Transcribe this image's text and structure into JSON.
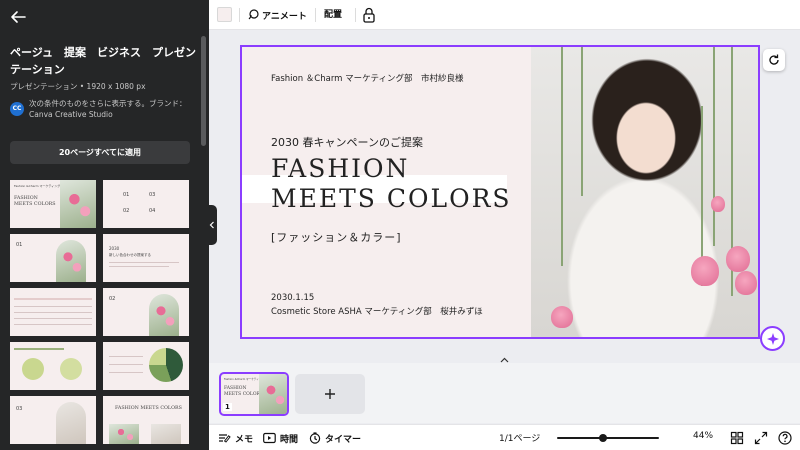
{
  "left_panel": {
    "title": "ページュ　提案　ビジネス　プレゼンテーション",
    "subtitle": "プレゼンテーション • 1920 x 1080 px",
    "brand_badge": "CC",
    "brand_description": "次の条件のものをさらに表示する。ブランド：Canva Creative Studio",
    "apply_all_label": "20ページすべてに適用",
    "thumbnails": {
      "t1": {
        "header": "Fashion &Charm マーケティング部",
        "title_line1": "FASHION",
        "title_line2": "MEETS COLORS"
      },
      "t2": {
        "num_a": "01",
        "num_b": "03",
        "num_c": "02",
        "num_d": "04"
      },
      "t3": {
        "num": "01"
      },
      "t4": {
        "year": "2030",
        "heading": "新しい色合わせの提案する"
      },
      "t6": {
        "num": "02"
      },
      "t9": {
        "num": "03"
      },
      "t10": {
        "title": "FASHION MEETS COLORS"
      }
    }
  },
  "toolbar": {
    "animate_label": "アニメート",
    "arrange_label": "配置"
  },
  "slide": {
    "header": "Fashion ＆Charm マーケティング部　市村紗良様",
    "proposal": "2030 春キャンペーンのご提案",
    "title_line1": "FASHION",
    "title_line2": "MEETS COLORS",
    "bracket_subtitle": "[ファッション＆カラー]",
    "date": "2030.1.15",
    "byline": "Cosmetic Store ASHA マーケティング部　桜井みずほ"
  },
  "page_strip": {
    "page_number": "1",
    "thumb_header": "Fashion &Charm マーケティング部",
    "thumb_title_line1": "FASHION",
    "thumb_title_line2": "MEETS COLORS"
  },
  "bottom_bar": {
    "notes_label": "メモ",
    "time_label": "時間",
    "timer_label": "タイマー",
    "page_count": "1/1ページ",
    "zoom": "44%",
    "zoom_level_percent": 44
  },
  "colors": {
    "accent": "#8b3dff",
    "panel_bg": "#252627",
    "slide_bg": "#f6eeee"
  }
}
